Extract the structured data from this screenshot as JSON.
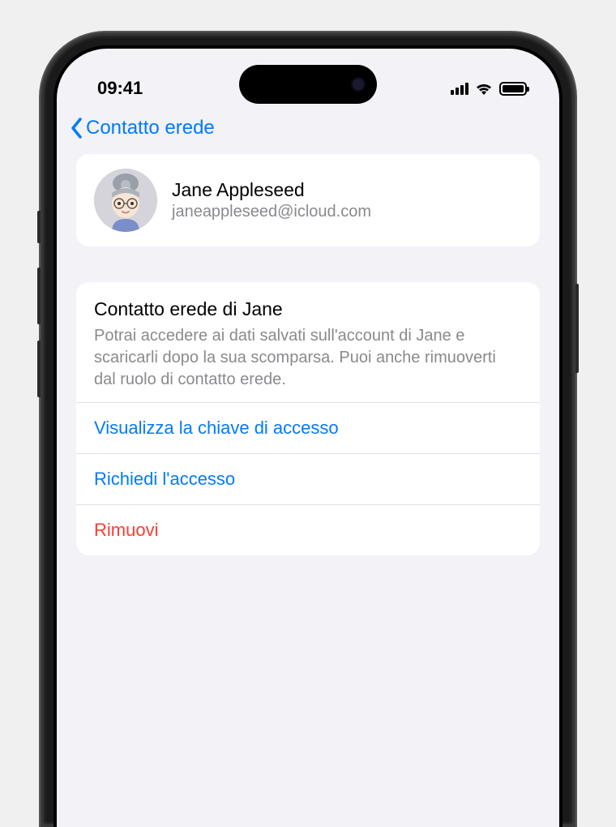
{
  "status": {
    "time": "09:41"
  },
  "nav": {
    "back_label": "Contatto erede"
  },
  "contact": {
    "name": "Jane Appleseed",
    "email": "janeappleseed@icloud.com"
  },
  "section": {
    "title": "Contatto erede di Jane",
    "description": "Potrai accedere ai dati salvati sull'account di Jane e scaricarli dopo la sua scomparsa. Puoi anche rimuoverti dal ruolo di contatto erede."
  },
  "actions": {
    "view_key": "Visualizza la chiave di accesso",
    "request_access": "Richiedi l'accesso",
    "remove": "Rimuovi"
  }
}
